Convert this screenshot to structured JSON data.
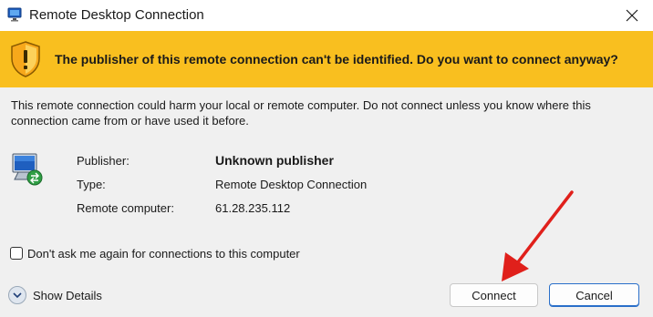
{
  "window": {
    "title": "Remote Desktop Connection",
    "icon": "remote-desktop-icon",
    "close_icon": "close-icon"
  },
  "banner": {
    "icon": "warning-shield-icon",
    "message": "The publisher of this remote connection can't be identified. Do you want to connect anyway?",
    "background": "#f9bf1f"
  },
  "warning": {
    "text": "This remote connection could harm your local or remote computer. Do not connect unless you know where this connection came from or have used it before."
  },
  "details": {
    "icon": "computer-icon",
    "rows": [
      {
        "label": "Publisher:",
        "value": "Unknown publisher"
      },
      {
        "label": "Type:",
        "value": "Remote Desktop Connection"
      },
      {
        "label": "Remote computer:",
        "value": "61.28.235.112"
      }
    ]
  },
  "checkbox": {
    "label": "Don't ask me again for connections to this computer",
    "checked": false
  },
  "footer": {
    "show_details_label": "Show Details",
    "connect_label": "Connect",
    "cancel_label": "Cancel"
  },
  "annotation": {
    "icon": "red-arrow-icon",
    "color": "#e0201b"
  }
}
